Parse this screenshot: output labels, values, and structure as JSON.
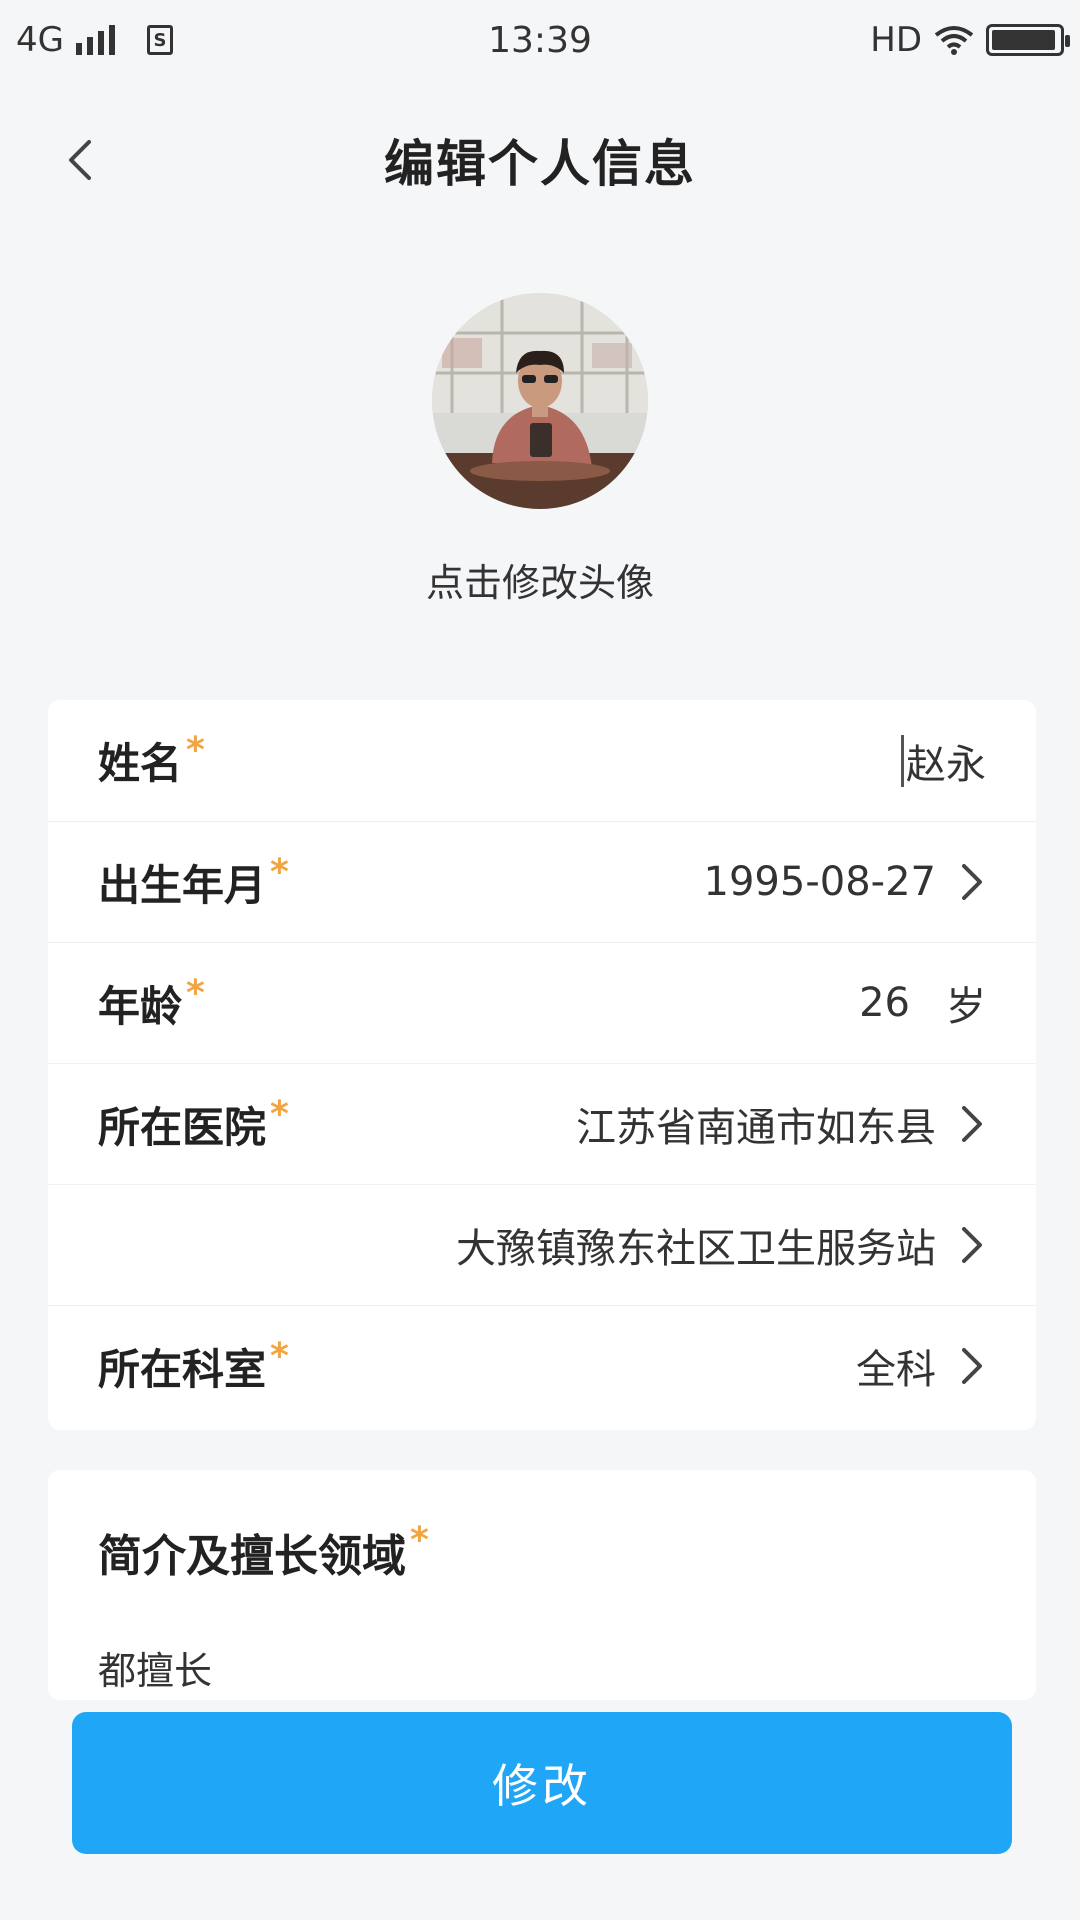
{
  "status_bar": {
    "network": "4G",
    "sim_label": "S",
    "time": "13:39",
    "hd_label": "HD",
    "battery_level": 0.95
  },
  "header": {
    "title": "编辑个人信息",
    "back_icon": "chevron-left-icon"
  },
  "avatar": {
    "hint": "点击修改头像"
  },
  "form": {
    "required_mark": "*",
    "rows": [
      {
        "label": "姓名",
        "value": "赵永"
      },
      {
        "label": "出生年月",
        "value": "1995-08-27"
      },
      {
        "label": "年龄",
        "value": "26",
        "unit": "岁"
      },
      {
        "label": "所在医院",
        "value": "江苏省南通市如东县"
      },
      {
        "label": "",
        "value": "大豫镇豫东社区卫生服务站"
      },
      {
        "label": "所在科室",
        "value": "全科"
      }
    ]
  },
  "intro": {
    "label": "简介及擅长领域",
    "text": "都擅长"
  },
  "submit_label": "修改",
  "colors": {
    "accent": "#1fa6f7",
    "required": "#f0a542",
    "background": "#f5f6f8"
  }
}
